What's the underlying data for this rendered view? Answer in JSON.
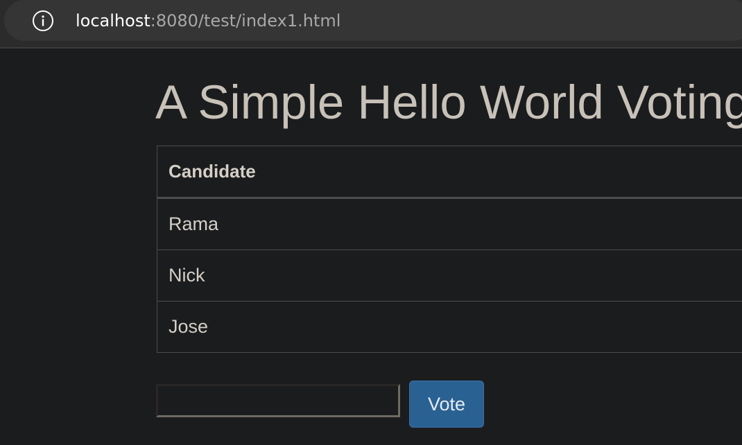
{
  "browser": {
    "url_host": "localhost",
    "url_rest": ":8080/test/index1.html",
    "info_icon": "info-circle-icon"
  },
  "page": {
    "title": "A Simple Hello World Voting Application"
  },
  "table": {
    "headers": [
      "Candidate"
    ],
    "rows": [
      {
        "candidate": "Rama"
      },
      {
        "candidate": "Nick"
      },
      {
        "candidate": "Jose"
      }
    ]
  },
  "vote_form": {
    "input_value": "",
    "button_label": "Vote",
    "button_color": "#2a6193"
  }
}
